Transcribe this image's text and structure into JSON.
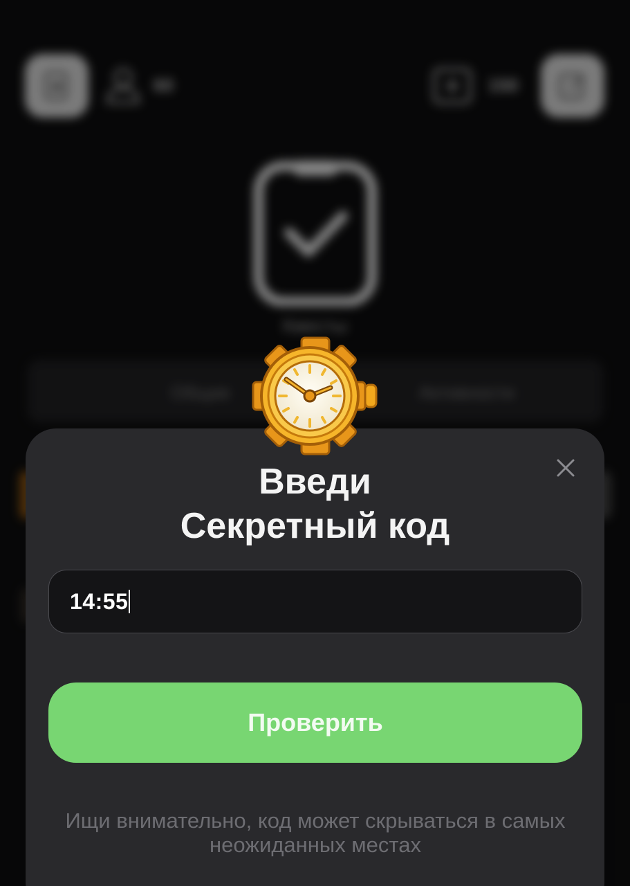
{
  "background": {
    "left_stat": "60",
    "right_stat": "150",
    "quest_label": "Квесты",
    "tabs": [
      "Общие",
      "Активности"
    ]
  },
  "modal": {
    "title_line1": "Введи",
    "title_line2": "Секретный код",
    "input_value": "14:55",
    "button_label": "Проверить",
    "hint": "Ищи внимательно, код может скрываться в самых неожиданных местах"
  },
  "icons": {
    "modal_badge": "pocket-watch-icon",
    "close": "close-icon",
    "left_top": "notes-icon",
    "right_top": "edit-icon",
    "user": "user-icon",
    "counter": "counter-icon",
    "quest": "checklist-icon"
  },
  "colors": {
    "modal_bg": "#29292c",
    "button": "#78d672",
    "input_bg": "#141416",
    "watch_gold": "#f2a81d"
  }
}
